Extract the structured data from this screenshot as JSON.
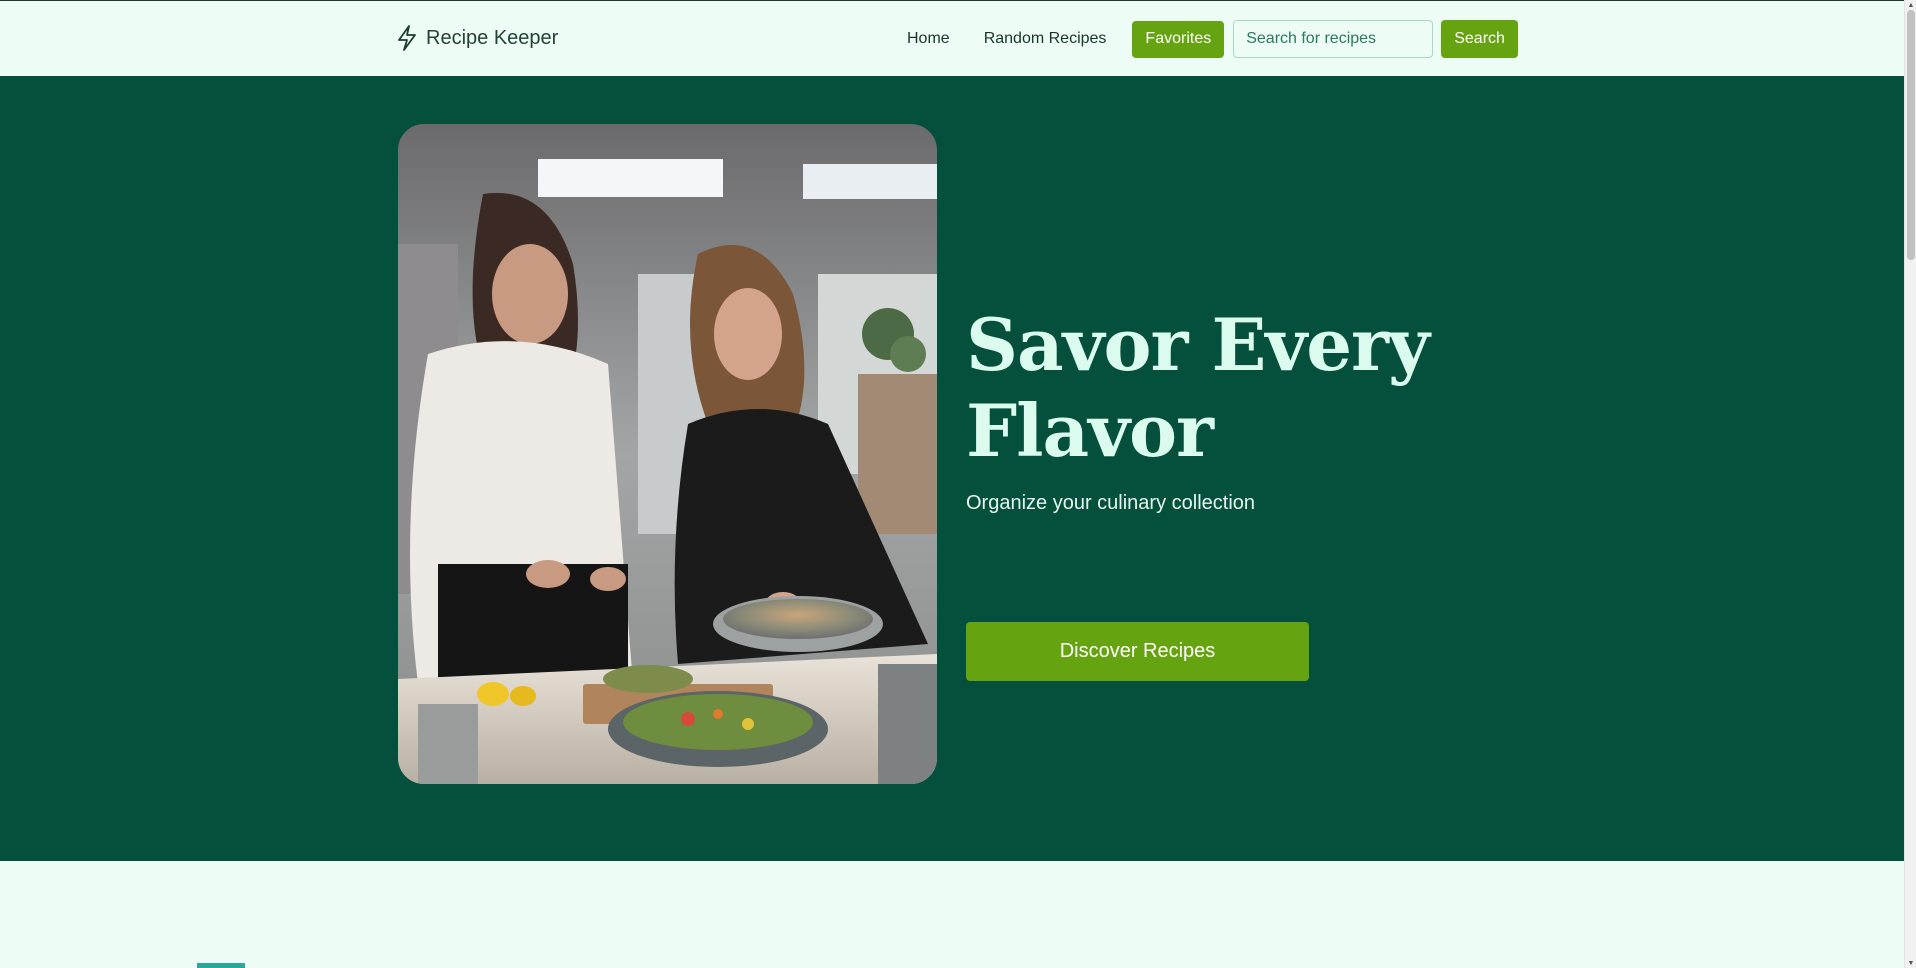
{
  "navbar": {
    "brand": {
      "icon": "lightning-bolt-icon",
      "name": "Recipe Keeper"
    },
    "links": {
      "home": "Home",
      "random": "Random Recipes"
    },
    "favorites_label": "Favorites",
    "search": {
      "placeholder": "Search for recipes",
      "value": "",
      "button_label": "Search"
    }
  },
  "hero": {
    "image": "two women cooking in a kitchen",
    "title": "Savor Every Flavor",
    "subtitle": "Organize your culinary collection",
    "cta_label": "Discover Recipes"
  },
  "colors": {
    "hero_background": "#05503c",
    "page_background": "#edfcf5",
    "accent_green": "#66a310",
    "title_color": "#dbfbef"
  }
}
